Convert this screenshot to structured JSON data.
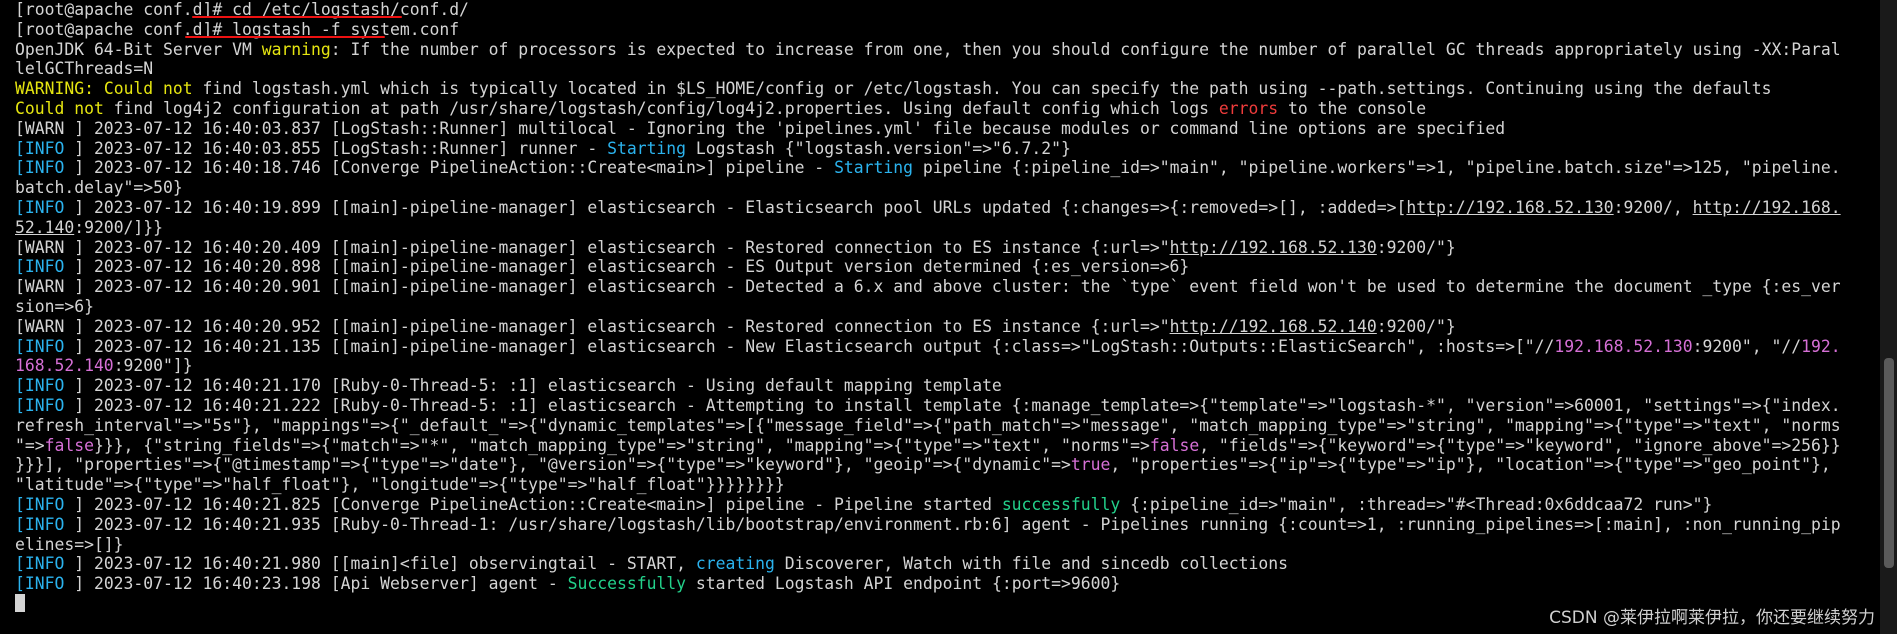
{
  "terminal": {
    "lines": [
      [
        {
          "t": "[root@apache conf.d]# cd /etc/logstash/conf.d/"
        }
      ],
      [
        {
          "t": "[root@apache conf.d]# logstash -f system.conf"
        }
      ],
      [
        {
          "t": "OpenJDK 64-Bit Server VM "
        },
        {
          "t": "warning",
          "c": "w"
        },
        {
          "t": ": If the number of processors is expected to increase from one, then you should configure the number of parallel GC threads appropriately using -XX:Paral"
        }
      ],
      [
        {
          "t": "lelGCThreads=N"
        }
      ],
      [
        {
          "t": "WARNING:",
          "c": "w"
        },
        {
          "t": " "
        },
        {
          "t": "Could not",
          "c": "w"
        },
        {
          "t": " find logstash.yml which is typically located in $LS_HOME/config or /etc/logstash. You can specify the path using --path.settings. Continuing using the defaults"
        }
      ],
      [
        {
          "t": "Could not",
          "c": "w"
        },
        {
          "t": " find log4j2 configuration at path /usr/share/logstash/config/log4j2.properties. Using default config which logs "
        },
        {
          "t": "errors",
          "c": "r"
        },
        {
          "t": " to the console"
        }
      ],
      [
        {
          "t": "[WARN ] 2023-07-12 16:40:03.837 [LogStash::Runner] multilocal - Ignoring the 'pipelines.yml' file because modules or command line options are specified"
        }
      ],
      [
        {
          "t": "[INFO",
          "c": "c"
        },
        {
          "t": " ] 2023-07-12 16:40:03.855 [LogStash::Runner] runner - "
        },
        {
          "t": "Starting",
          "c": "c"
        },
        {
          "t": " Logstash {\"logstash.version\"=>\"6.7.2\"}"
        }
      ],
      [
        {
          "t": "[INFO",
          "c": "c"
        },
        {
          "t": " ] 2023-07-12 16:40:18.746 [Converge PipelineAction::Create<main>] pipeline - "
        },
        {
          "t": "Starting",
          "c": "c"
        },
        {
          "t": " pipeline {:pipeline_id=>\"main\", \"pipeline.workers\"=>1, \"pipeline.batch.size\"=>125, \"pipeline."
        }
      ],
      [
        {
          "t": "batch.delay\"=>50}"
        }
      ],
      [
        {
          "t": "[INFO",
          "c": "c"
        },
        {
          "t": " ] 2023-07-12 16:40:19.899 [[main]-pipeline-manager] elasticsearch - Elasticsearch pool URLs updated {:changes=>{:removed=>[], :added=>["
        },
        {
          "t": "http://192.168.52.130",
          "c": "u"
        },
        {
          "t": ":9200/, "
        },
        {
          "t": "http://192.168.",
          "c": "u"
        }
      ],
      [
        {
          "t": "52.140",
          "c": "u"
        },
        {
          "t": ":9200/]}}"
        }
      ],
      [
        {
          "t": "[WARN ] 2023-07-12 16:40:20.409 [[main]-pipeline-manager] elasticsearch - Restored connection to ES instance {:url=>\""
        },
        {
          "t": "http://192.168.52.130",
          "c": "u"
        },
        {
          "t": ":9200/\"}"
        }
      ],
      [
        {
          "t": "[INFO",
          "c": "c"
        },
        {
          "t": " ] 2023-07-12 16:40:20.898 [[main]-pipeline-manager] elasticsearch - ES Output version determined {:es_version=>6}"
        }
      ],
      [
        {
          "t": "[WARN ] 2023-07-12 16:40:20.901 [[main]-pipeline-manager] elasticsearch - Detected a 6.x and above cluster: the `type` event field won't be used to determine the document _type {:es_ver"
        }
      ],
      [
        {
          "t": "sion=>6}"
        }
      ],
      [
        {
          "t": "[WARN ] 2023-07-12 16:40:20.952 [[main]-pipeline-manager] elasticsearch - Restored connection to ES instance {:url=>\""
        },
        {
          "t": "http://192.168.52.140",
          "c": "u"
        },
        {
          "t": ":9200/\"}"
        }
      ],
      [
        {
          "t": "[INFO",
          "c": "c"
        },
        {
          "t": " ] 2023-07-12 16:40:21.135 [[main]-pipeline-manager] elasticsearch - New Elasticsearch output {:class=>\"LogStash::Outputs::ElasticSearch\", :hosts=>[\"//"
        },
        {
          "t": "192.168.52.130",
          "c": "m"
        },
        {
          "t": ":9200\", \"//"
        },
        {
          "t": "192.",
          "c": "m"
        }
      ],
      [
        {
          "t": "168.52.140",
          "c": "m"
        },
        {
          "t": ":9200\"]}"
        }
      ],
      [
        {
          "t": "[INFO",
          "c": "c"
        },
        {
          "t": " ] 2023-07-12 16:40:21.170 [Ruby-0-Thread-5: :1] elasticsearch - Using default mapping template"
        }
      ],
      [
        {
          "t": "[INFO",
          "c": "c"
        },
        {
          "t": " ] 2023-07-12 16:40:21.222 [Ruby-0-Thread-5: :1] elasticsearch - Attempting to install template {:manage_template=>{\"template\"=>\"logstash-*\", \"version\"=>60001, \"settings\"=>{\"index."
        }
      ],
      [
        {
          "t": "refresh_interval\"=>\"5s\"}, \"mappings\"=>{\"_default_\"=>{\"dynamic_templates\"=>[{\"message_field\"=>{\"path_match\"=>\"message\", \"match_mapping_type\"=>\"string\", \"mapping\"=>{\"type\"=>\"text\", \"norms"
        }
      ],
      [
        {
          "t": "\"=>"
        },
        {
          "t": "false",
          "c": "m"
        },
        {
          "t": "}}}, {\"string_fields\"=>{\"match\"=>\"*\", \"match_mapping_type\"=>\"string\", \"mapping\"=>{\"type\"=>\"text\", \"norms\"=>"
        },
        {
          "t": "false",
          "c": "m"
        },
        {
          "t": ", \"fields\"=>{\"keyword\"=>{\"type\"=>\"keyword\", \"ignore_above\"=>256}}"
        }
      ],
      [
        {
          "t": "}}}], \"properties\"=>{\"@timestamp\"=>{\"type\"=>\"date\"}, \"@version\"=>{\"type\"=>\"keyword\"}, \"geoip\"=>{\"dynamic\"=>"
        },
        {
          "t": "true",
          "c": "m"
        },
        {
          "t": ", \"properties\"=>{\"ip\"=>{\"type\"=>\"ip\"}, \"location\"=>{\"type\"=>\"geo_point\"},"
        }
      ],
      [
        {
          "t": "\"latitude\"=>{\"type\"=>\"half_float\"}, \"longitude\"=>{\"type\"=>\"half_float\"}}}}}}}}"
        }
      ],
      [
        {
          "t": "[INFO",
          "c": "c"
        },
        {
          "t": " ] 2023-07-12 16:40:21.825 [Converge PipelineAction::Create<main>] pipeline - Pipeline started "
        },
        {
          "t": "successfully",
          "c": "g"
        },
        {
          "t": " {:pipeline_id=>\"main\", :thread=>\"#<Thread:0x6ddcaa72 run>\"}"
        }
      ],
      [
        {
          "t": "[INFO",
          "c": "c"
        },
        {
          "t": " ] 2023-07-12 16:40:21.935 [Ruby-0-Thread-1: /usr/share/logstash/lib/bootstrap/environment.rb:6] agent - Pipelines running {:count=>1, :running_pipelines=>[:main], :non_running_pip"
        }
      ],
      [
        {
          "t": "elines=>[]}"
        }
      ],
      [
        {
          "t": "[INFO",
          "c": "c"
        },
        {
          "t": " ] 2023-07-12 16:40:21.980 [[main]<file] observingtail - START, "
        },
        {
          "t": "creating",
          "c": "c"
        },
        {
          "t": " Discoverer, Watch with file and sincedb collections"
        }
      ],
      [
        {
          "t": "[INFO",
          "c": "c"
        },
        {
          "t": " ] 2023-07-12 16:40:23.198 [Api Webserver] agent - "
        },
        {
          "t": "Successfully",
          "c": "g"
        },
        {
          "t": " started Logstash API endpoint {:port=>9600}"
        }
      ]
    ]
  },
  "watermark": "CSDN @莱伊拉啊莱伊拉，你还要继续努力",
  "colors": {
    "background": "#000000",
    "text": "#d4d4d4",
    "warning_yellow": "#e5e510",
    "error_red": "#ee3b3b",
    "info_cyan": "#2bb3ee",
    "success_green": "#23d18b",
    "literal_magenta": "#d670d6",
    "annotation_red": "#e11111"
  }
}
